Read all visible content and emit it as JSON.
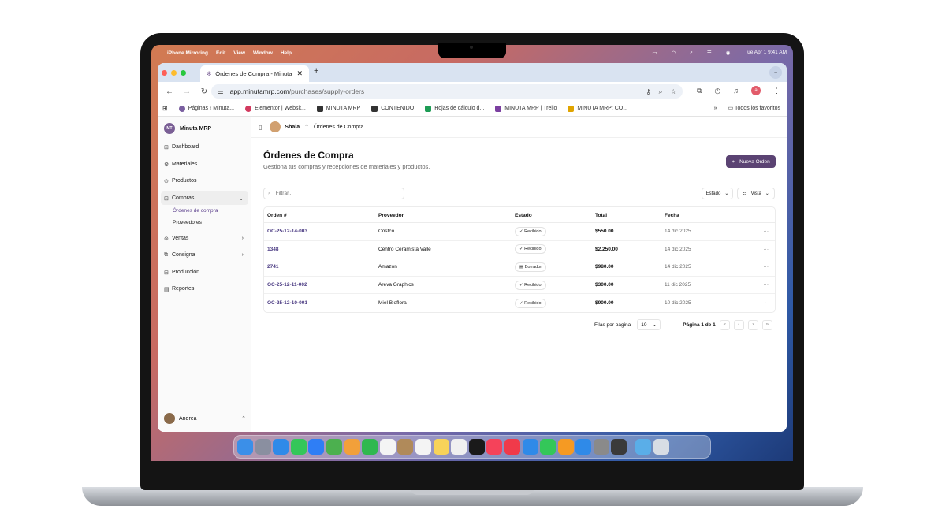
{
  "menubar": {
    "app": "iPhone Mirroring",
    "items": [
      "Edit",
      "View",
      "Window",
      "Help"
    ],
    "datetime": "Tue Apr 1  9:41 AM"
  },
  "browser": {
    "tab_title": "Órdenes de Compra - Minuta",
    "url_host": "app.minutamrp.com",
    "url_path": "/purchases/supply-orders",
    "profile_initial": "a",
    "bookmarks": [
      {
        "label": "Páginas ‹ Minuta...",
        "color": "#7a5fa0"
      },
      {
        "label": "Elementor | Websit...",
        "color": "#d23a5f"
      },
      {
        "label": "MINUTA MRP",
        "color": "#333333"
      },
      {
        "label": "CONTENIDO",
        "color": "#333333"
      },
      {
        "label": "Hojas de cálculo d...",
        "color": "#1e9c55"
      },
      {
        "label": "MINUTA MRP | Trello",
        "color": "#7b3fa0"
      },
      {
        "label": "MINUTA MRP: CO...",
        "color": "#e0a400"
      }
    ],
    "bookmarks_more": "»",
    "all_favorites": "Todos los favoritos"
  },
  "sidebar": {
    "brand": "Minuta MRP",
    "brand_logo": "MT",
    "items": [
      {
        "label": "Dashboard",
        "icon": "⊞"
      },
      {
        "label": "Materiales",
        "icon": "⚙"
      },
      {
        "label": "Productos",
        "icon": "⊙"
      },
      {
        "label": "Compras",
        "icon": "⊡",
        "chev": "⌄"
      },
      {
        "label": "Ventas",
        "icon": "⊜",
        "chev": "›"
      },
      {
        "label": "Consigna",
        "icon": "⧉",
        "chev": "›"
      },
      {
        "label": "Producción",
        "icon": "⊟"
      },
      {
        "label": "Reportes",
        "icon": "▤"
      }
    ],
    "subitems": [
      "Órdenes de compra",
      "Proveedores"
    ],
    "user": "Andrea",
    "user_chev": "⌃"
  },
  "topbar": {
    "org": "Shala",
    "org_chev": "⌃",
    "page": "Órdenes de Compra"
  },
  "page": {
    "title": "Órdenes de Compra",
    "subtitle": "Gestiona tus compras y recepciones de materiales y productos.",
    "new_button": "Nueva Orden",
    "filter_placeholder": "Filtrar...",
    "estado_button": "Estado",
    "vista_button": "Vista"
  },
  "table": {
    "headers": [
      "Orden #",
      "Proveedor",
      "Estado",
      "Total",
      "Fecha"
    ],
    "rows": [
      {
        "order": "OC-25-12-14-003",
        "supplier": "Costco",
        "status": "Recibido",
        "status_icon": "✓",
        "total": "$550.00",
        "date": "14 dic 2025"
      },
      {
        "order": "1348",
        "supplier": "Centro Ceramista Valle",
        "status": "Recibido",
        "status_icon": "✓",
        "total": "$2,250.00",
        "date": "14 dic 2025"
      },
      {
        "order": "2741",
        "supplier": "Amazon",
        "status": "Borrador",
        "status_icon": "▤",
        "total": "$980.00",
        "date": "14 dic 2025"
      },
      {
        "order": "OC-25-12-11-002",
        "supplier": "Areva Graphics",
        "status": "Recibido",
        "status_icon": "✓",
        "total": "$300.00",
        "date": "11 dic 2025"
      },
      {
        "order": "OC-25-12-10-001",
        "supplier": "Miel Bioflora",
        "status": "Recibido",
        "status_icon": "✓",
        "total": "$900.00",
        "date": "10 dic 2025"
      }
    ],
    "row_menu": "···"
  },
  "pagination": {
    "rows_label": "Filas por página",
    "rows_value": "10",
    "page_label": "Página 1 de 1",
    "buttons": [
      "«",
      "‹",
      "›",
      "»"
    ]
  },
  "dock": {
    "apps": [
      {
        "name": "finder-icon",
        "color": "#3b8fe8"
      },
      {
        "name": "launchpad-icon",
        "color": "#8a8fa0"
      },
      {
        "name": "safari-icon",
        "color": "#2f8ae8"
      },
      {
        "name": "messages-icon",
        "color": "#34c759"
      },
      {
        "name": "mail-icon",
        "color": "#2f7ef5"
      },
      {
        "name": "maps-icon",
        "color": "#4cb04f"
      },
      {
        "name": "photos-icon",
        "color": "#f2a03a"
      },
      {
        "name": "facetime-icon",
        "color": "#2fb84f"
      },
      {
        "name": "calendar-icon",
        "color": "#f4f4f4"
      },
      {
        "name": "contacts-icon",
        "color": "#b08a5a"
      },
      {
        "name": "reminders-icon",
        "color": "#f4f4f4"
      },
      {
        "name": "notes-icon",
        "color": "#f7d35a"
      },
      {
        "name": "freeform-icon",
        "color": "#f0f0f0"
      },
      {
        "name": "tv-icon",
        "color": "#1a1a1a"
      },
      {
        "name": "music-icon",
        "color": "#f5425a"
      },
      {
        "name": "news-icon",
        "color": "#f03a4a"
      },
      {
        "name": "keynote-icon",
        "color": "#2f8ae8"
      },
      {
        "name": "numbers-icon",
        "color": "#34c759"
      },
      {
        "name": "pages-icon",
        "color": "#f59a23"
      },
      {
        "name": "app-store-icon",
        "color": "#2f8ae8"
      },
      {
        "name": "system-settings-icon",
        "color": "#8a8a8a"
      },
      {
        "name": "iphone-mirroring-icon",
        "color": "#3a3a3a"
      },
      {
        "name": "downloads-folder-icon",
        "color": "#5aaee8"
      },
      {
        "name": "trash-icon",
        "color": "#d8dde4"
      }
    ]
  }
}
